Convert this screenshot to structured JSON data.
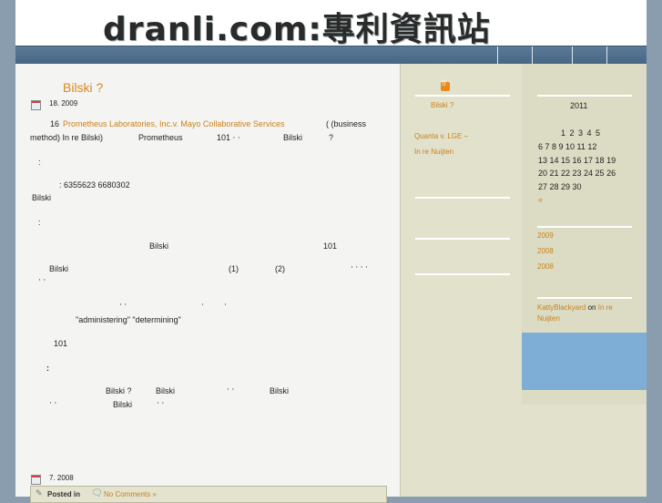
{
  "site": {
    "logo_text": "dranli.com:專利資訊站"
  },
  "post1": {
    "title": "Bilski    ?",
    "date": "18. 2009",
    "line1_num": "16",
    "line1_link": "Prometheus Laboratories, Inc.v. Mayo Collaborative Services",
    "line1_end": "(      (business",
    "line2_a": "method)   In re Bilski)",
    "line2_b": "Prometheus",
    "line2_c": "101   ‧   ‧",
    "line2_d": "Bilski",
    "line2_e": "?",
    "colon1": ":",
    "patents": ": 6355623   6680302",
    "bilski1": "Bilski",
    "colon2": ":",
    "bilski2": "Bilski",
    "num101a": "101",
    "bilski3": "Bilski",
    "one": "(1)",
    "two": "(2)",
    "dots1": "‧ ‧ ‧   ‧",
    "dots2": "‧ ‧",
    "dots3": "‧ ‧",
    "dot4": "‧",
    "dot5": "‧",
    "quote": "\"administering\" \"determining\"",
    "num101b": "101",
    "colon3": ":",
    "last_a": "Bilski     ?",
    "last_b": "Bilski",
    "last_c": "‧    ‧",
    "last_d": "Bilski",
    "last_e": "‧ ‧",
    "last_f": "Bilski",
    "last_g": "‧    ‧",
    "posted_in": "Posted in",
    "comments": "No Comments »"
  },
  "post2": {
    "date": "7. 2008"
  },
  "sidebar1": {
    "links": [
      "Bilski    ?",
      "Quanta v. LGE –",
      "In re Nuijten"
    ]
  },
  "sidebar2": {
    "cal_year": "2011",
    "cal_rows": [
      "1  2  3  4  5",
      "6  7  8  9  10 11 12",
      "13 14 15 16 17 18 19",
      "20 21 22 23 24 25 26",
      "27 28 29 30"
    ],
    "cal_prev": "«",
    "archives": [
      "2009",
      "2008",
      "2008"
    ],
    "comment_author": "KattyBlackyard",
    "comment_on": "on",
    "comment_post": "In re Nuijten"
  },
  "colors": {
    "accent": "#d9891c",
    "navbar": "#476683",
    "background": "#8a9daf"
  }
}
